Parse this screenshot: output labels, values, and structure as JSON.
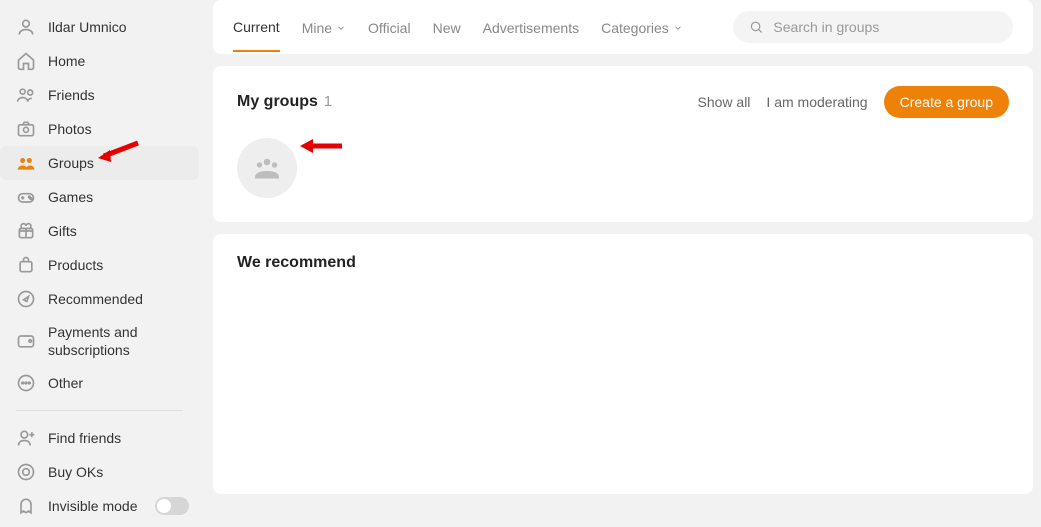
{
  "sidebar": {
    "items": [
      {
        "label": "Ildar Umnico"
      },
      {
        "label": "Home"
      },
      {
        "label": "Friends"
      },
      {
        "label": "Photos"
      },
      {
        "label": "Groups"
      },
      {
        "label": "Games"
      },
      {
        "label": "Gifts"
      },
      {
        "label": "Products"
      },
      {
        "label": "Recommended"
      },
      {
        "label": "Payments and subscriptions"
      },
      {
        "label": "Other"
      }
    ],
    "secondary": [
      {
        "label": "Find friends"
      },
      {
        "label": "Buy OKs"
      },
      {
        "label": "Invisible mode"
      }
    ]
  },
  "tabs": {
    "current": "Current",
    "mine": "Mine",
    "official": "Official",
    "new": "New",
    "advertisements": "Advertisements",
    "categories": "Categories"
  },
  "search": {
    "placeholder": "Search in groups"
  },
  "groups": {
    "title": "My groups",
    "count": "1",
    "show_all": "Show all",
    "moderating": "I am moderating",
    "create": "Create a group"
  },
  "recommend": {
    "title": "We recommend"
  }
}
